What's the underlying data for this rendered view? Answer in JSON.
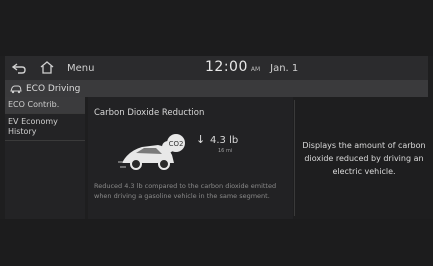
{
  "topbar": {
    "menu_label": "Menu",
    "time": "12:00",
    "ampm": "AM",
    "date": "Jan. 1"
  },
  "title": {
    "text": "ECO Driving"
  },
  "sidebar": {
    "items": [
      {
        "label": "ECO Contrib."
      },
      {
        "label": "EV Economy History"
      }
    ]
  },
  "main": {
    "section_title": "Carbon Dioxide Reduction",
    "value": "4.3 lb",
    "sub_value": "16 mi",
    "co2_label": "CO2",
    "description": "Reduced 4.3 lb compared to the carbon dioxide emitted when driving a gasoline vehicle in the same segment."
  },
  "right_panel": {
    "text": "Displays the amount of carbon dioxide reduced by driving an electric vehicle."
  }
}
